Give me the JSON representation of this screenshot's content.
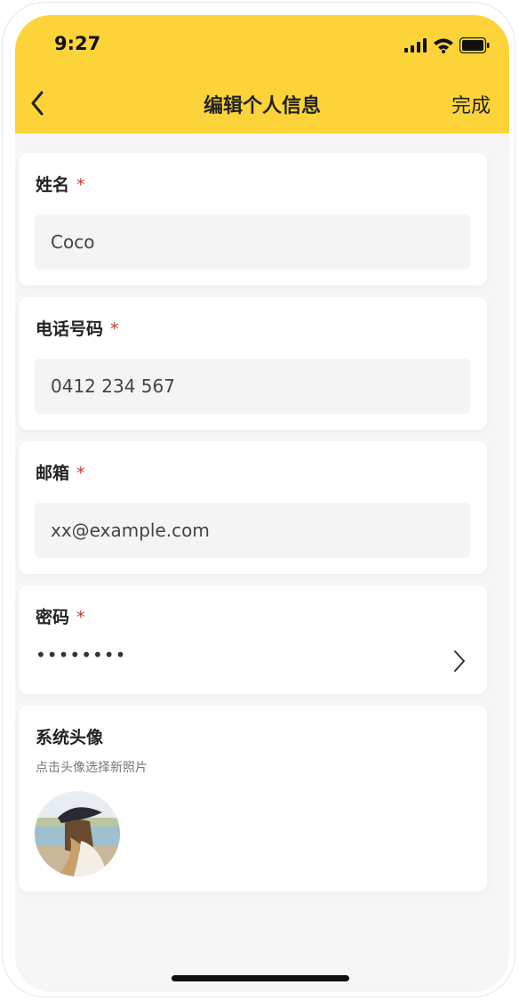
{
  "status_bar": {
    "time": "9:27"
  },
  "nav": {
    "title": "编辑个人信息",
    "done_label": "完成"
  },
  "form": {
    "name": {
      "label": "姓名",
      "required_mark": "*",
      "value": "Coco"
    },
    "phone": {
      "label": "电话号码",
      "required_mark": "*",
      "value": "0412 234 567"
    },
    "email": {
      "label": "邮箱",
      "required_mark": "*",
      "value": "xx@example.com"
    },
    "password": {
      "label": "密码",
      "required_mark": "*",
      "masked_value": "••••••••"
    },
    "avatar": {
      "label": "系统头像",
      "hint": "点击头像选择新照片"
    }
  },
  "colors": {
    "header_bg": "#fcd43a",
    "required": "#c23b2b",
    "field_bg": "#f4f4f4",
    "page_bg": "#f6f6f6"
  },
  "icons": [
    "back-arrow-icon",
    "signal-icon",
    "wifi-icon",
    "battery-icon",
    "chevron-right-icon"
  ]
}
